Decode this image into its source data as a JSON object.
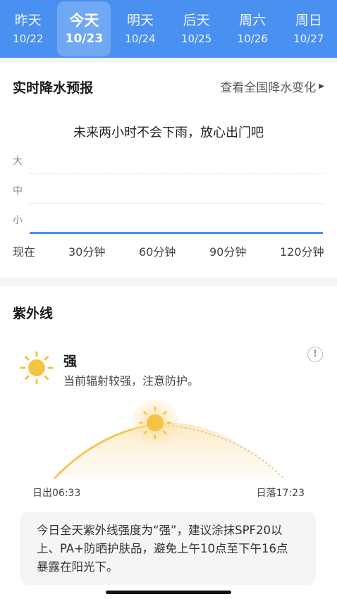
{
  "days": [
    {
      "name": "昨天",
      "date": "10/22",
      "active": false
    },
    {
      "name": "今天",
      "date": "10/23",
      "active": true
    },
    {
      "name": "明天",
      "date": "10/24",
      "active": false
    },
    {
      "name": "后天",
      "date": "10/25",
      "active": false
    },
    {
      "name": "周六",
      "date": "10/26",
      "active": false
    },
    {
      "name": "周日",
      "date": "10/27",
      "active": false
    }
  ],
  "precip": {
    "title": "实时降水预报",
    "link": "查看全国降水变化",
    "message": "未来两小时不会下雨，放心出门吧",
    "levels": [
      "大",
      "中",
      "小"
    ],
    "times": [
      "现在",
      "30分钟",
      "60分钟",
      "90分钟",
      "120分钟"
    ],
    "intensity": 0
  },
  "uv": {
    "title": "紫外线",
    "level": "强",
    "desc": "当前辐射较强，注意防护。",
    "sunrise": "日出06:33",
    "sunset": "日落17:23",
    "tip": "今日全天紫外线强度为“强”，建议涂抹SPF20以上、PA+防晒护肤品，避免上午10点至下午16点暴露在阳光下。"
  },
  "colors": {
    "accent": "#4a90f0",
    "sun": "#f6c244"
  }
}
